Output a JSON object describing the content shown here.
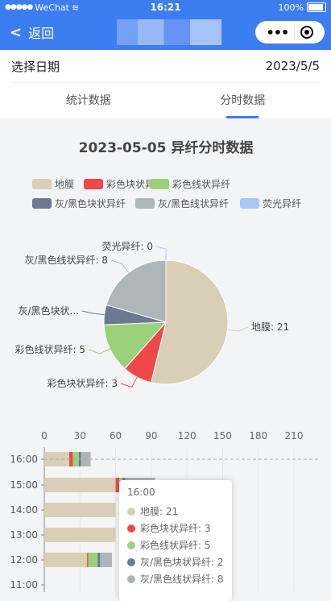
{
  "status_bar": {
    "carrier": "WeChat",
    "time": "16:21",
    "battery": "100%"
  },
  "nav": {
    "back_label": "返回"
  },
  "date_select": {
    "label": "选择日期",
    "value": "2023/5/5"
  },
  "tabs": [
    {
      "label": "统计数据",
      "active": false
    },
    {
      "label": "分时数据",
      "active": true
    }
  ],
  "colors": {
    "accent": "#3d7df2",
    "series": [
      "#d9cfb7",
      "#f04848",
      "#9bd17a",
      "#6b7a92",
      "#adb6b8",
      "#a9c7f5"
    ]
  },
  "chart_data": [
    {
      "type": "pie",
      "title": "2023-05-05 异纤分时数据",
      "legend_position": "top",
      "slices": [
        {
          "name": "地膜",
          "value": 21
        },
        {
          "name": "彩色块状异纤",
          "value": 3
        },
        {
          "name": "彩色线状异纤",
          "value": 5
        },
        {
          "name": "灰/黑色块状异纤",
          "value": 2
        },
        {
          "name": "灰/黑色线状异纤",
          "value": 8
        },
        {
          "name": "荧光异纤",
          "value": 0
        }
      ],
      "slice_labels": [
        "地膜: 21",
        "彩色块状异纤: 3",
        "彩色线状异纤: 5",
        "灰/黑色块状...",
        "灰/黑色线状异纤: 8",
        "荧光异纤: 0"
      ]
    },
    {
      "type": "bar",
      "orientation": "horizontal",
      "stacked": true,
      "xlim": [
        0,
        210
      ],
      "x_ticks": [
        "0",
        "30",
        "60",
        "90",
        "120",
        "150",
        "180",
        "210"
      ],
      "categories": [
        "16:00",
        "15:00",
        "14:00",
        "13:00",
        "12:00",
        "11:00"
      ],
      "series": [
        {
          "name": "地膜",
          "values": [
            21,
            60,
            60,
            60,
            36,
            0
          ]
        },
        {
          "name": "彩色块状异纤",
          "values": [
            3,
            3,
            0,
            0,
            1,
            0
          ]
        },
        {
          "name": "彩色线状异纤",
          "values": [
            5,
            3,
            0,
            0,
            8,
            0
          ]
        },
        {
          "name": "灰/黑色块状异纤",
          "values": [
            2,
            2,
            0,
            0,
            2,
            0
          ]
        },
        {
          "name": "灰/黑色线状异纤",
          "values": [
            8,
            25,
            0,
            0,
            10,
            0
          ]
        },
        {
          "name": "荧光异纤",
          "values": [
            0,
            0,
            0,
            0,
            0,
            0
          ]
        }
      ]
    }
  ],
  "tooltip": {
    "title": "16:00",
    "rows": [
      "地膜: 21",
      "彩色块状异纤: 3",
      "彩色线状异纤: 5",
      "灰/黑色块状异纤: 2",
      "灰/黑色线状异纤: 8"
    ]
  }
}
